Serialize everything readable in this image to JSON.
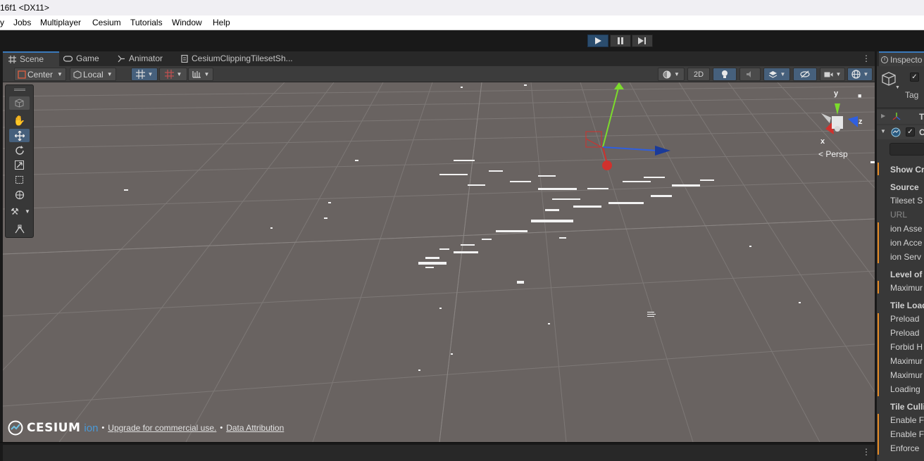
{
  "window": {
    "title": "16f1 <DX11>"
  },
  "menu": [
    "y",
    "Jobs",
    "Multiplayer",
    "Cesium",
    "Tutorials",
    "Window",
    "Help"
  ],
  "play_controls": {
    "play": "play-icon",
    "pause": "pause-icon",
    "step": "step-icon",
    "playing": true
  },
  "scene_tabs": [
    {
      "label": "Scene",
      "icon": "scene-grid-icon",
      "active": true
    },
    {
      "label": "Game",
      "icon": "gamepad-icon",
      "active": false
    },
    {
      "label": "Animator",
      "icon": "animator-icon",
      "active": false
    },
    {
      "label": "CesiumClippingTilesetSh...",
      "icon": "script-icon",
      "active": false
    }
  ],
  "scene_toolbar": {
    "pivot_mode": "Center",
    "pivot_rotation": "Local",
    "view_2d": "2D"
  },
  "scene_gizmo": {
    "axis_y": "y",
    "axis_z": "z",
    "axis_x": "x",
    "projection": "Persp"
  },
  "cesium_credits": {
    "logo": "CESIUM",
    "ion": "ion",
    "upgrade_link": "Upgrade for commercial use.",
    "separator": "•",
    "attribution_link": "Data Attribution"
  },
  "inspector": {
    "tab_label": "Inspecto",
    "tag_label": "Tag",
    "component_row1": "T",
    "component_row2": "C",
    "properties": [
      {
        "label": "Show Cr",
        "bold": true
      },
      {
        "label": "Source",
        "bold": false
      },
      {
        "label": "Tileset S",
        "bold": false
      },
      {
        "label": "URL",
        "bold": false,
        "dim": true
      },
      {
        "label": "ion Asse",
        "bold": false
      },
      {
        "label": "ion Acce",
        "bold": false
      },
      {
        "label": "ion Serv",
        "bold": false
      },
      {
        "label": "Level of",
        "bold": false
      },
      {
        "label": "Maximur",
        "bold": false
      },
      {
        "label": "Tile Load",
        "bold": false
      },
      {
        "label": "Preload",
        "bold": false
      },
      {
        "label": "Preload",
        "bold": false
      },
      {
        "label": "Forbid H",
        "bold": false
      },
      {
        "label": "Maximur",
        "bold": false
      },
      {
        "label": "Maximur",
        "bold": false
      },
      {
        "label": "Loading",
        "bold": false
      },
      {
        "label": "Tile Culli",
        "bold": false
      },
      {
        "label": "Enable F",
        "bold": false
      },
      {
        "label": "Enable F",
        "bold": false
      },
      {
        "label": "Enforce",
        "bold": false
      }
    ]
  },
  "colors": {
    "accent_blue": "#46607c",
    "modified_orange": "#e58a24",
    "viewport_bg": "#696361",
    "gizmo_x": "#d0312d",
    "gizmo_y": "#7cdc2c",
    "gizmo_z": "#2f5fe0"
  }
}
